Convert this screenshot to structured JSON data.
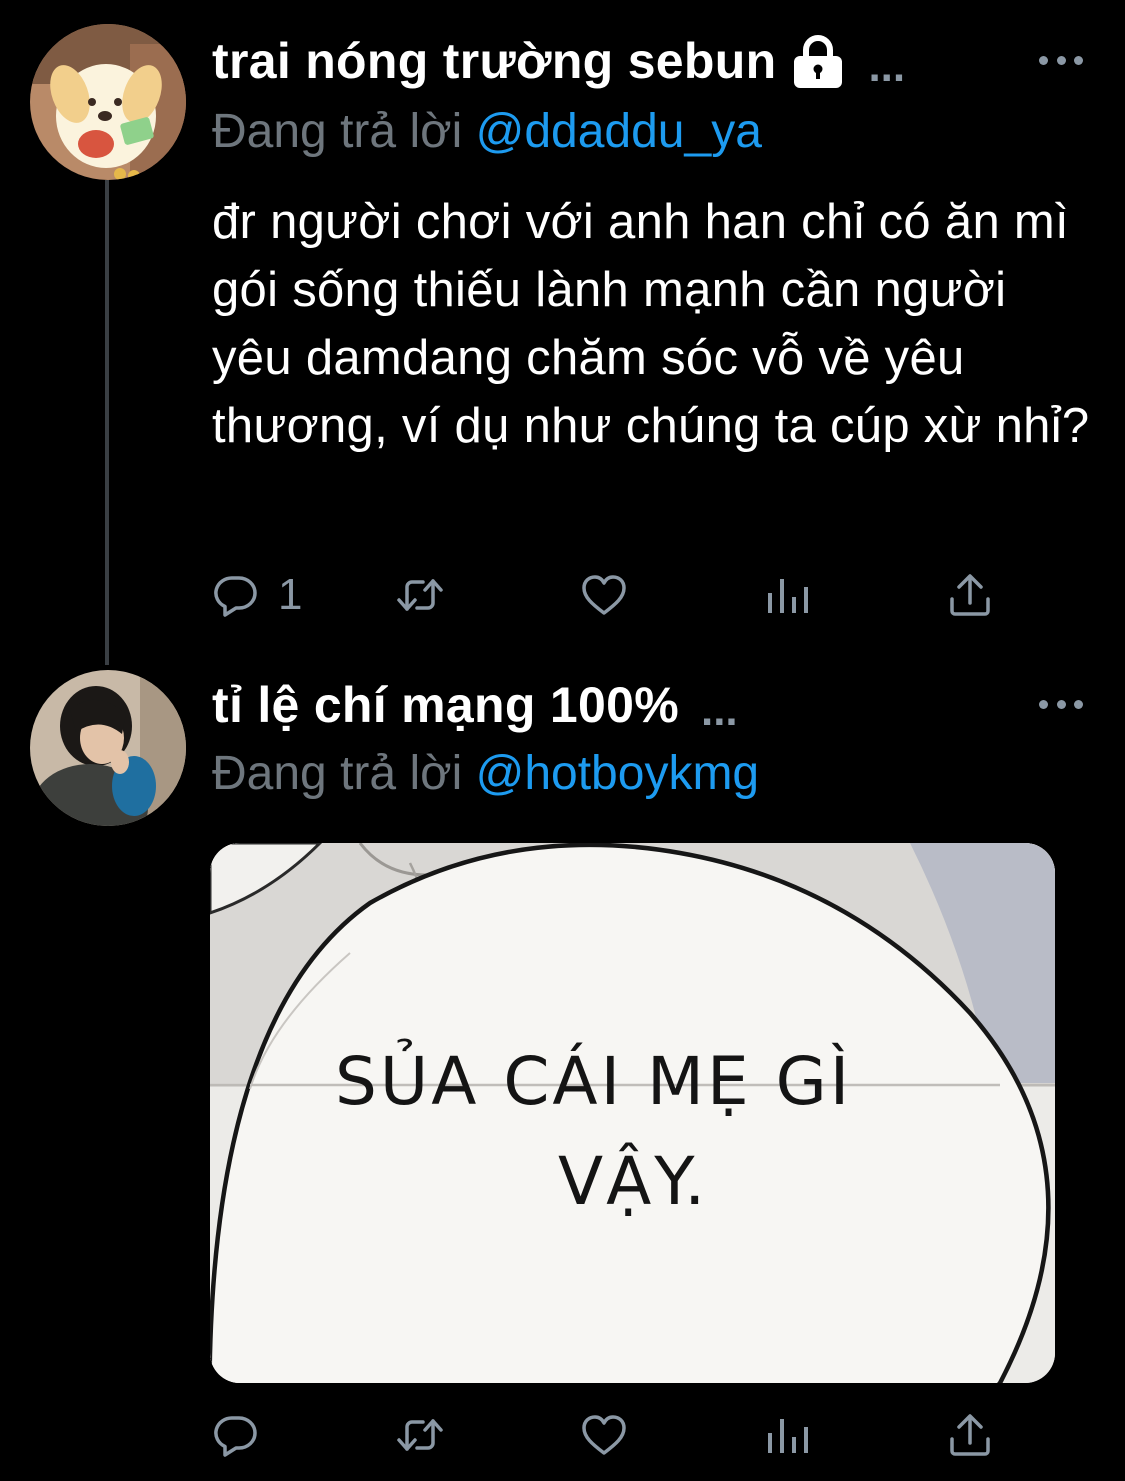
{
  "tweets": [
    {
      "display_name": "trai nóng trường sebun",
      "handle_truncated": "...",
      "locked": true,
      "reply_prefix": "Đang trả lời",
      "reply_to": "@ddaddu_ya",
      "text": "đr người chơi với anh han chỉ có ăn mì gói sống thiếu lành mạnh cần người yêu damdang chăm sóc vỗ về yêu thương, ví dụ như chúng ta cúp xừ nhỉ?",
      "reply_count": "1",
      "retweet_count": "",
      "like_count": ""
    },
    {
      "display_name": "tỉ lệ chí mạng 100%",
      "handle_truncated": "...",
      "locked": false,
      "reply_prefix": "Đang trả lời",
      "reply_to": "@hotboykmg",
      "text": "",
      "media": {
        "caption_line1": "SỦA CÁI MẸ GÌ",
        "caption_line2": "VẬY."
      },
      "reply_count": "",
      "retweet_count": "",
      "like_count": ""
    }
  ],
  "icons": {
    "reply": "reply-icon",
    "retweet": "retweet-icon",
    "like": "heart-icon",
    "analytics": "analytics-icon",
    "share": "share-icon",
    "more": "more-icon",
    "lock": "lock-icon"
  },
  "colors": {
    "background": "#000000",
    "text": "#ffffff",
    "secondary": "#6e767d",
    "icon": "#8b98a5",
    "link": "#1d9bf0",
    "thread_line": "#3a3f44"
  }
}
